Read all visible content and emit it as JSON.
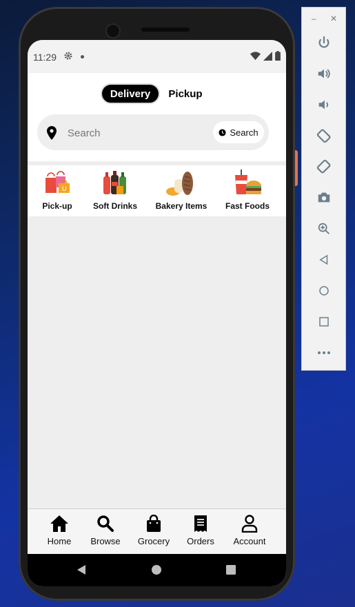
{
  "status_bar": {
    "time": "11:29"
  },
  "header": {
    "tabs": [
      {
        "label": "Delivery",
        "selected": true
      },
      {
        "label": "Pickup",
        "selected": false
      }
    ],
    "search": {
      "placeholder": "Search",
      "value": "",
      "button_label": "Search"
    }
  },
  "categories": [
    {
      "label": "Pick-up",
      "icon": "shopping-bags-icon"
    },
    {
      "label": "Soft Drinks",
      "icon": "soda-bottles-icon"
    },
    {
      "label": "Bakery Items",
      "icon": "bread-icon"
    },
    {
      "label": "Fast Foods",
      "icon": "burger-drink-icon"
    }
  ],
  "bottom_nav": [
    {
      "label": "Home",
      "icon": "home-icon"
    },
    {
      "label": "Browse",
      "icon": "search-icon"
    },
    {
      "label": "Grocery",
      "icon": "bag-icon"
    },
    {
      "label": "Orders",
      "icon": "receipt-icon"
    },
    {
      "label": "Account",
      "icon": "user-icon"
    }
  ],
  "emulator_toolbar": [
    "power-icon",
    "volume-up-icon",
    "volume-down-icon",
    "rotate-left-icon",
    "rotate-right-icon",
    "camera-icon",
    "zoom-icon",
    "back-icon",
    "home-circle-icon",
    "overview-icon",
    "more-icon"
  ],
  "colors": {
    "accent": "#000000",
    "background": "#eeeeee",
    "surface": "#ffffff"
  }
}
